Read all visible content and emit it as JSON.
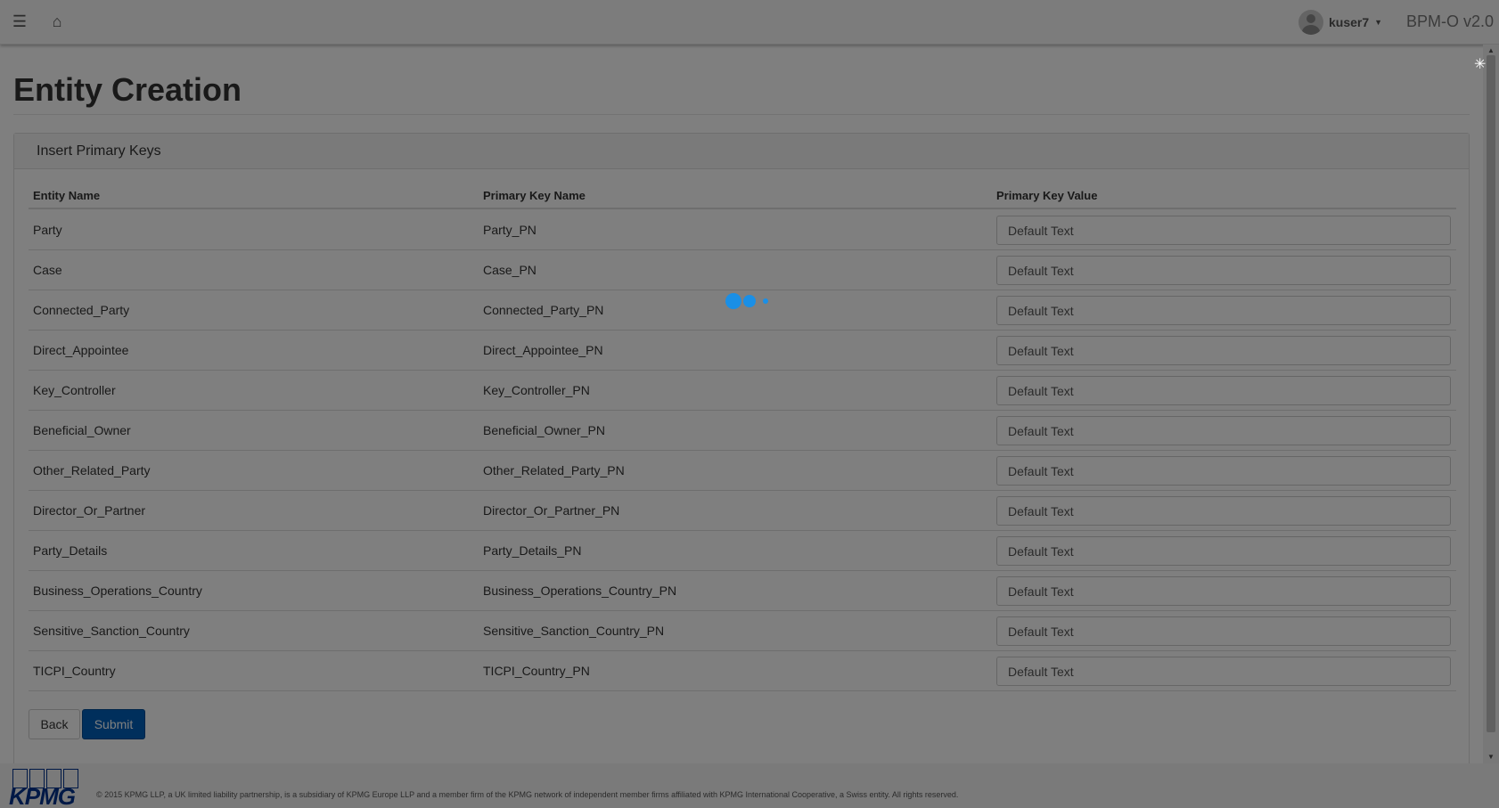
{
  "navbar": {
    "menu_icon": "hamburger-icon",
    "home_icon": "home-icon",
    "username": "kuser7",
    "brand": "BPM-O v2.0"
  },
  "page": {
    "title": "Entity Creation"
  },
  "panel": {
    "heading": "Insert Primary Keys",
    "columns": [
      "Entity Name",
      "Primary Key Name",
      "Primary Key Value"
    ],
    "rows": [
      {
        "entity": "Party",
        "pk_name": "Party_PN",
        "pk_value": "Default Text"
      },
      {
        "entity": "Case",
        "pk_name": "Case_PN",
        "pk_value": "Default Text"
      },
      {
        "entity": "Connected_Party",
        "pk_name": "Connected_Party_PN",
        "pk_value": "Default Text"
      },
      {
        "entity": "Direct_Appointee",
        "pk_name": "Direct_Appointee_PN",
        "pk_value": "Default Text"
      },
      {
        "entity": "Key_Controller",
        "pk_name": "Key_Controller_PN",
        "pk_value": "Default Text"
      },
      {
        "entity": "Beneficial_Owner",
        "pk_name": "Beneficial_Owner_PN",
        "pk_value": "Default Text"
      },
      {
        "entity": "Other_Related_Party",
        "pk_name": "Other_Related_Party_PN",
        "pk_value": "Default Text"
      },
      {
        "entity": "Director_Or_Partner",
        "pk_name": "Director_Or_Partner_PN",
        "pk_value": "Default Text"
      },
      {
        "entity": "Party_Details",
        "pk_name": "Party_Details_PN",
        "pk_value": "Default Text"
      },
      {
        "entity": "Business_Operations_Country",
        "pk_name": "Business_Operations_Country_PN",
        "pk_value": "Default Text"
      },
      {
        "entity": "Sensitive_Sanction_Country",
        "pk_name": "Sensitive_Sanction_Country_PN",
        "pk_value": "Default Text"
      },
      {
        "entity": "TICPI_Country",
        "pk_name": "TICPI_Country_PN",
        "pk_value": "Default Text"
      }
    ],
    "back_label": "Back",
    "submit_label": "Submit"
  },
  "footer": {
    "logo_text": "KPMG",
    "copyright": "© 2015 KPMG LLP, a UK limited liability partnership, is a subsidiary of KPMG Europe LLP and a member firm of the KPMG network of independent member firms affiliated with KPMG International Cooperative, a Swiss entity. All rights reserved."
  },
  "colors": {
    "primary_button": "#005eb8",
    "loader_dots": "#1a8fe6",
    "overlay": "rgba(0,0,0,0.5)"
  }
}
